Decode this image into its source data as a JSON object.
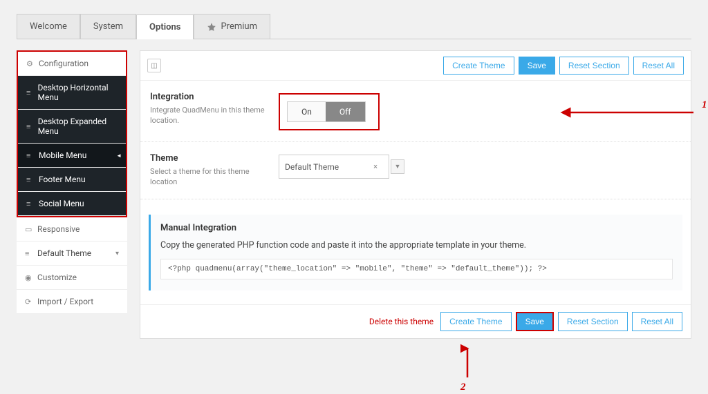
{
  "tabs": {
    "welcome": "Welcome",
    "system": "System",
    "options": "Options",
    "premium": "Premium"
  },
  "sidebar": {
    "config": "Configuration",
    "items": [
      "Desktop Horizontal Menu",
      "Desktop Expanded Menu",
      "Mobile Menu",
      "Footer Menu",
      "Social Menu"
    ],
    "responsive": "Responsive",
    "default_theme": "Default Theme",
    "customize": "Customize",
    "import_export": "Import / Export"
  },
  "buttons": {
    "create_theme": "Create Theme",
    "save": "Save",
    "reset_section": "Reset Section",
    "reset_all": "Reset All",
    "delete": "Delete this theme"
  },
  "integration": {
    "title": "Integration",
    "desc": "Integrate QuadMenu in this theme location.",
    "on": "On",
    "off": "Off"
  },
  "theme": {
    "title": "Theme",
    "desc": "Select a theme for this theme location",
    "value": "Default Theme"
  },
  "manual": {
    "title": "Manual Integration",
    "desc": "Copy the generated PHP function code and paste it into the appropriate template in your theme.",
    "code": "<?php quadmenu(array(\"theme_location\" => \"mobile\", \"theme\" => \"default_theme\")); ?>"
  },
  "callouts": {
    "one": "1",
    "two": "2"
  }
}
